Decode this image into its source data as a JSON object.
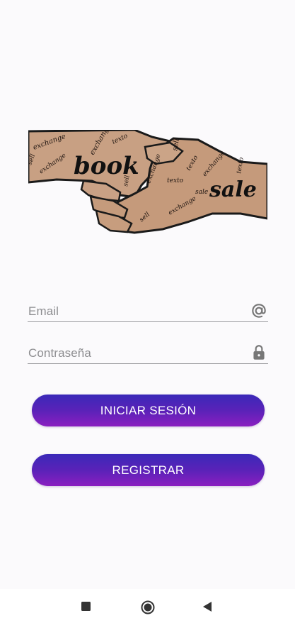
{
  "logo": {
    "words": [
      "book",
      "sale",
      "exchange",
      "sell",
      "texto",
      "exchange",
      "sell",
      "texto"
    ]
  },
  "form": {
    "email_placeholder": "Email",
    "password_placeholder": "Contraseña",
    "email_icon": "at-icon",
    "password_icon": "lock-icon"
  },
  "buttons": {
    "login_label": "INICIAR SESIÓN",
    "register_label": "REGISTRAR"
  },
  "navbar": {
    "icons": [
      "recents-square-icon",
      "home-circle-icon",
      "back-triangle-icon"
    ]
  },
  "colors": {
    "button_top": "#3a29b8",
    "button_bottom": "#8a1fc0",
    "hand_skin": "#c79d7e"
  }
}
